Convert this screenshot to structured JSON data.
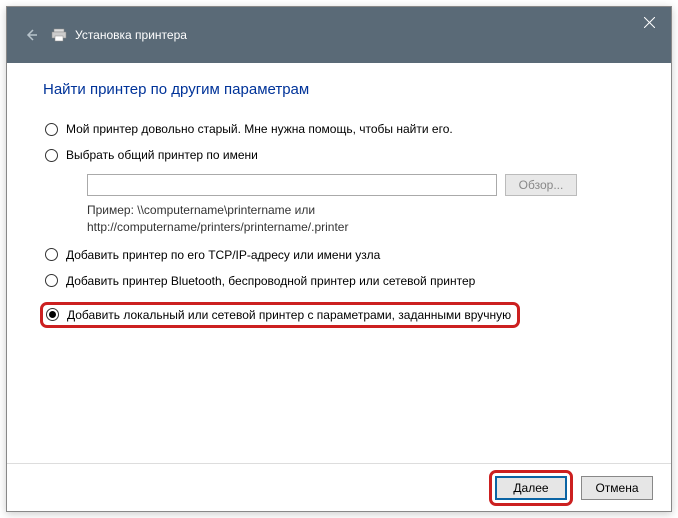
{
  "titlebar": {
    "title": "Установка принтера"
  },
  "heading": "Найти принтер по другим параметрам",
  "options": {
    "old_printer": "Мой принтер довольно старый. Мне нужна помощь, чтобы найти его.",
    "shared_by_name": "Выбрать общий принтер по имени",
    "tcpip": "Добавить принтер по его TCP/IP-адресу или имени узла",
    "bluetooth": "Добавить принтер Bluetooth, беспроводной принтер или сетевой принтер",
    "manual": "Добавить локальный или сетевой принтер с параметрами, заданными вручную"
  },
  "shared": {
    "input_value": "",
    "browse_label": "Обзор...",
    "example_line1": "Пример: \\\\computername\\printername или",
    "example_line2": "http://computername/printers/printername/.printer"
  },
  "footer": {
    "next": "Далее",
    "cancel": "Отмена"
  },
  "selected_index": 4
}
